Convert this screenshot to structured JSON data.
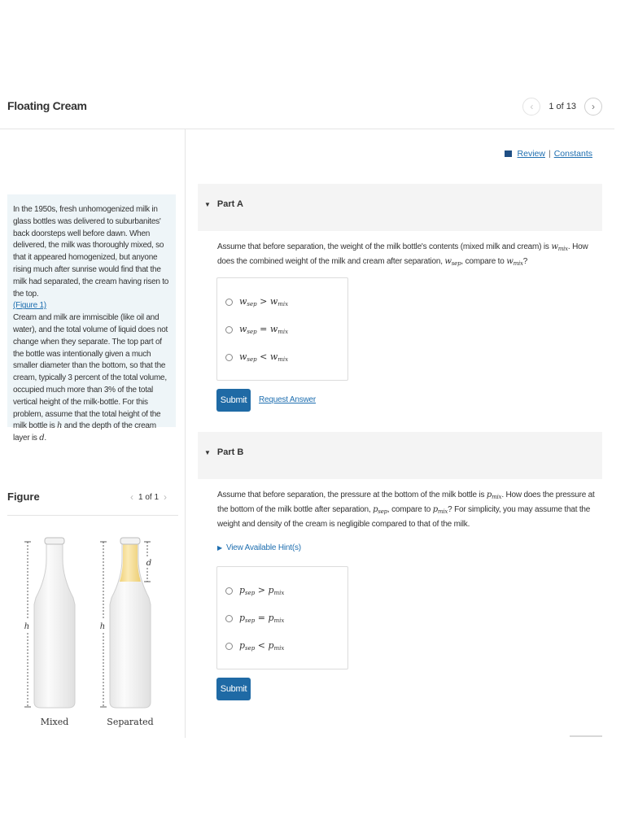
{
  "header": {
    "title": "Floating Cream",
    "pager_text": "1 of 13"
  },
  "links": {
    "review": "Review",
    "separator": "|",
    "constants": "Constants"
  },
  "intro": {
    "text1": "In the 1950s, fresh unhomogenized milk in glass bottles was delivered to suburbanites' back doorsteps well before dawn. When delivered, the milk was thoroughly mixed, so that it appeared homogenized, but anyone rising much after sunrise would find that the milk had separated, the cream having risen to the top.",
    "figure_link": "(Figure 1)",
    "text2": "Cream and milk are immiscible (like oil and water), and the total volume of liquid does not change when they separate. The top part of the bottle was intentionally given a much smaller diameter than the bottom, so that the cream, typically 3 percent of the total volume, occupied much more than 3% of the total vertical height of the milk-bottle. For this problem, assume that the total height of the milk bottle is",
    "var_h": "h",
    "text3": "and the depth of the cream layer is",
    "var_d": "d",
    "text4": "."
  },
  "figure": {
    "title": "Figure",
    "pager_text": "1 of 1",
    "label_mixed": "Mixed",
    "label_separated": "Separated",
    "label_h": "h",
    "label_d": "d"
  },
  "part_a": {
    "title": "Part A",
    "q1": "Assume that before separation, the weight of the milk bottle's contents (mixed milk and cream) is",
    "q2": ". How does the combined weight of the milk and cream after separation,",
    "q3": ", compare to",
    "q4": "?",
    "choices": [
      {
        "lhs": "w",
        "lhs_sub": "sep",
        "op": ">",
        "rhs": "w",
        "rhs_sub": "mix"
      },
      {
        "lhs": "w",
        "lhs_sub": "sep",
        "op": "=",
        "rhs": "w",
        "rhs_sub": "mix"
      },
      {
        "lhs": "w",
        "lhs_sub": "sep",
        "op": "<",
        "rhs": "w",
        "rhs_sub": "mix"
      }
    ],
    "submit": "Submit",
    "request_answer": "Request Answer"
  },
  "part_b": {
    "title": "Part B",
    "q1": "Assume that before separation, the pressure at the bottom of the milk bottle is",
    "q2": ". How does the pressure at the bottom of the milk bottle after separation,",
    "q3": ", compare to",
    "q4": "? For simplicity, you may assume that the weight and density of the cream is negligible compared to that of the milk.",
    "hint": "View Available Hint(s)",
    "choices": [
      {
        "lhs": "p",
        "lhs_sub": "sep",
        "op": ">",
        "rhs": "p",
        "rhs_sub": "mix"
      },
      {
        "lhs": "p",
        "lhs_sub": "sep",
        "op": "=",
        "rhs": "p",
        "rhs_sub": "mix"
      },
      {
        "lhs": "p",
        "lhs_sub": "sep",
        "op": "<",
        "rhs": "p",
        "rhs_sub": "mix"
      }
    ],
    "submit": "Submit"
  },
  "math": {
    "w": "w",
    "p": "p",
    "sep": "sep",
    "mix": "mix"
  },
  "colors": {
    "accent": "#1f6aa5",
    "link": "#1f6fb0",
    "intro_bg": "#eef5f8",
    "cream": "#f4df9a"
  }
}
